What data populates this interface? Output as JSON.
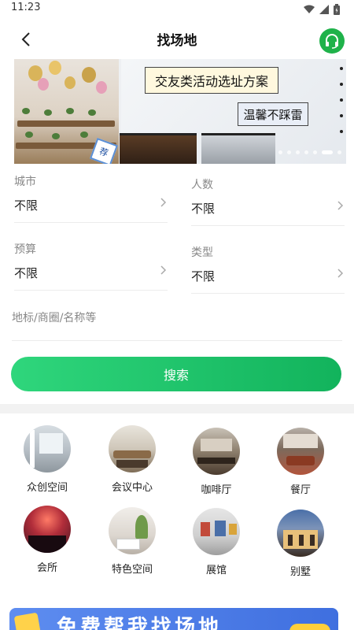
{
  "status_bar": {
    "time": "11:23"
  },
  "nav": {
    "title": "找场地"
  },
  "banner": {
    "headline": "交友类活动选址方案",
    "subline": "温馨不踩雷",
    "sticker": "荐",
    "page_count": 7,
    "active_page": 6
  },
  "form": {
    "city": {
      "label": "城市",
      "value": "不限"
    },
    "people": {
      "label": "人数",
      "value": "不限"
    },
    "budget": {
      "label": "预算",
      "value": "不限"
    },
    "type": {
      "label": "类型",
      "value": "不限"
    },
    "keyword": {
      "placeholder": "地标/商圈/名称等"
    },
    "search_label": "搜索"
  },
  "categories": [
    {
      "label": "众创空间",
      "icon": "coworking-photo"
    },
    {
      "label": "会议中心",
      "icon": "conference-photo"
    },
    {
      "label": "咖啡厅",
      "icon": "cafe-photo"
    },
    {
      "label": "餐厅",
      "icon": "restaurant-photo"
    },
    {
      "label": "会所",
      "icon": "club-photo"
    },
    {
      "label": "特色空间",
      "icon": "special-space-photo"
    },
    {
      "label": "展馆",
      "icon": "exhibition-photo"
    },
    {
      "label": "别墅",
      "icon": "villa-photo"
    }
  ],
  "bottom_banner": {
    "text": "免费帮我找场地"
  },
  "colors": {
    "accent": "#1fb24a",
    "search_gradient_start": "#2fd67c",
    "search_gradient_end": "#12b35c"
  }
}
